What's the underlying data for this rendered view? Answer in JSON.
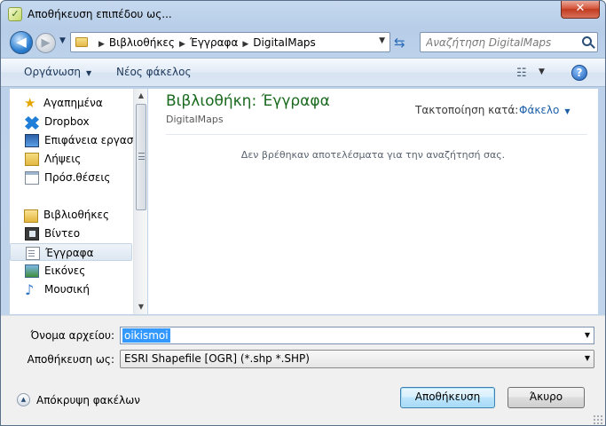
{
  "window": {
    "title": "Αποθήκευση επιπέδου ως...",
    "close_symbol": "✕"
  },
  "nav": {
    "back_symbol": "◀",
    "forward_symbol": "▶",
    "breadcrumb": [
      "Βιβλιοθήκες",
      "Έγγραφα",
      "DigitalMaps"
    ],
    "search_placeholder": "Αναζήτηση DigitalMaps"
  },
  "toolbar": {
    "organize_label": "Οργάνωση",
    "new_folder_label": "Νέος φάκελος",
    "help_label": "?"
  },
  "navpane": {
    "favorites_header": "Αγαπημένα",
    "favorites": [
      "Dropbox",
      "Επιφάνεια εργασ",
      "Λήψεις",
      "Πρόσ.θέσεις"
    ],
    "libraries_header": "Βιβλιοθήκες",
    "libraries": [
      "Βίντεο",
      "Έγγραφα",
      "Εικόνες",
      "Μουσική"
    ],
    "selected": "Έγγραφα"
  },
  "content": {
    "library_title": "Βιβλιοθήκη: Έγγραφα",
    "library_subtitle": "DigitalMaps",
    "arrange_label": "Τακτοποίηση κατά:",
    "arrange_value": "Φάκελο",
    "empty_message": "Δεν βρέθηκαν αποτελέσματα για την αναζήτησή σας."
  },
  "form": {
    "filename_label": "Όνομα αρχείου:",
    "filename_value": "oikismoi",
    "savetype_label": "Αποθήκευση ως:",
    "savetype_value": "ESRI Shapefile [OGR] (*.shp *.SHP)"
  },
  "footer": {
    "hide_folders_label": "Απόκρυψη φακέλων",
    "save_label": "Αποθήκευση",
    "cancel_label": "Άκυρο"
  },
  "colors": {
    "library_title": "#1a6a1e",
    "toolbar_text": "#1e395b",
    "link_blue": "#1c5fa8",
    "selection": "#3399ff"
  },
  "icons": {
    "favorites": "star-icon",
    "dropbox": "dropbox-icon",
    "desktop": "desktop-icon",
    "downloads": "downloads-folder-icon",
    "recent": "recent-places-icon",
    "libraries": "libraries-icon",
    "videos": "video-icon",
    "documents": "documents-icon",
    "pictures": "pictures-icon",
    "music": "music-note-icon"
  }
}
